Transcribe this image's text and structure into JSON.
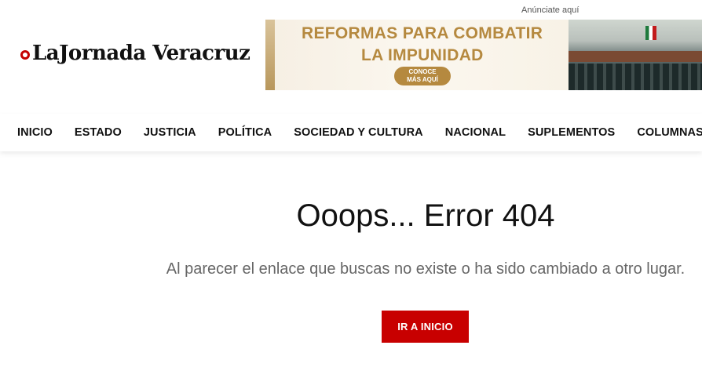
{
  "site": {
    "logo_text": "LaJornada Veracruz"
  },
  "ad": {
    "label": "Anúnciate aquí",
    "headline_line1": "REFORMAS PARA COMBATIR",
    "headline_line2": "LA IMPUNIDAD",
    "cta_line1": "CONOCE",
    "cta_line2": "MÁS AQUÍ"
  },
  "nav": {
    "items": [
      {
        "label": "INICIO"
      },
      {
        "label": "ESTADO"
      },
      {
        "label": "JUSTICIA"
      },
      {
        "label": "POLÍTICA"
      },
      {
        "label": "SOCIEDAD Y CULTURA"
      },
      {
        "label": "NACIONAL"
      },
      {
        "label": "SUPLEMENTOS"
      },
      {
        "label": "COLUMNAS"
      }
    ]
  },
  "error": {
    "title": "Ooops... Error 404",
    "message": "Al parecer el enlace que buscas no existe o ha sido cambiado a otro lugar.",
    "button_label": "IR A INICIO"
  },
  "colors": {
    "accent": "#c80000",
    "ad_gold": "#b5893f"
  }
}
